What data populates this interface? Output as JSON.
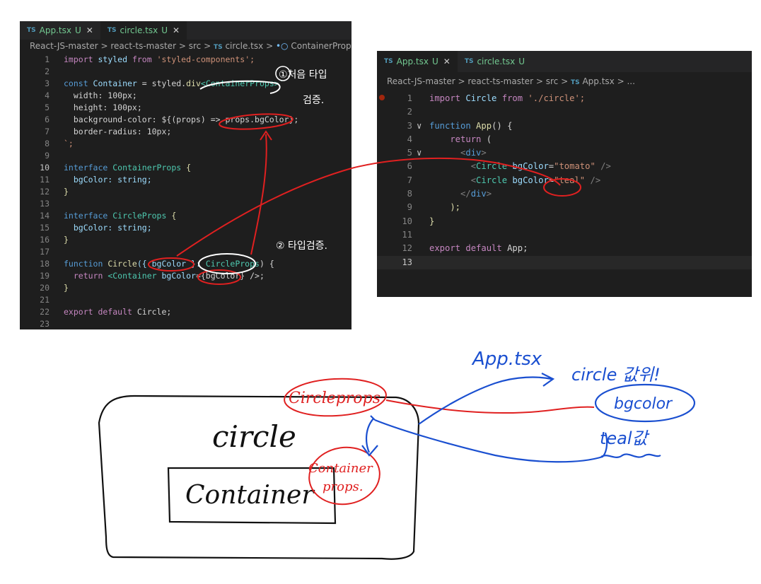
{
  "left_editor": {
    "tabs": [
      {
        "lang": "TS",
        "name": "App.tsx",
        "status": "U",
        "close": "✕",
        "active": false
      },
      {
        "lang": "TS",
        "name": "circle.tsx",
        "status": "U",
        "close": "✕",
        "active": true
      }
    ],
    "breadcrumb": {
      "p1": "React-JS-master",
      "p2": "react-ts-master",
      "p3": "src",
      "lang": "TS",
      "p4": "circle.tsx",
      "p5": "ContainerProps",
      "sep": ">",
      "sym": "•○"
    },
    "lines": [
      {
        "n": "1",
        "a": "import",
        "b": " styled ",
        "c": "from",
        "d": " 'styled-components';"
      },
      {
        "n": "2"
      },
      {
        "n": "3",
        "a": "const",
        "b": " Container",
        "c": " = styled.",
        "d": "div",
        "e": "<ContainerProps>`"
      },
      {
        "n": "4",
        "a": "  width: 100px;"
      },
      {
        "n": "5",
        "a": "  height: 100px;"
      },
      {
        "n": "6",
        "a": "  background-color: ${(props) => props.bgColor};"
      },
      {
        "n": "7",
        "a": "  border-radius: 10px;"
      },
      {
        "n": "8",
        "a": "`;"
      },
      {
        "n": "9"
      },
      {
        "n": "10",
        "a": "interface",
        "b": " ContainerProps",
        "c": " {"
      },
      {
        "n": "11",
        "a": "  bgColor: string;"
      },
      {
        "n": "12",
        "a": "}"
      },
      {
        "n": "13"
      },
      {
        "n": "14",
        "a": "interface",
        "b": " CircleProps",
        "c": " {"
      },
      {
        "n": "15",
        "a": "  bgColor: string;"
      },
      {
        "n": "16",
        "a": "}"
      },
      {
        "n": "17"
      },
      {
        "n": "18",
        "a": "function",
        "b": " Circle",
        "c": "({ bgColor }: ",
        "d": "CircleProps",
        "e": ") {"
      },
      {
        "n": "19",
        "a": "  return",
        "b": " <Container ",
        "c": "bgColor",
        "d": "={bgColor} />;"
      },
      {
        "n": "20",
        "a": "}"
      },
      {
        "n": "21"
      },
      {
        "n": "22",
        "a": "export default",
        "b": " Circle;"
      },
      {
        "n": "23"
      }
    ]
  },
  "right_editor": {
    "tabs": [
      {
        "lang": "TS",
        "name": "App.tsx",
        "status": "U",
        "close": "✕",
        "active": true
      },
      {
        "lang": "TS",
        "name": "circle.tsx",
        "status": "U",
        "active": false
      }
    ],
    "breadcrumb": {
      "p1": "React-JS-master",
      "p2": "react-ts-master",
      "p3": "src",
      "lang": "TS",
      "p4": "App.tsx",
      "p5": "...",
      "sep": ">"
    },
    "lines": [
      {
        "n": "1",
        "a": "import",
        "b": " Circle ",
        "c": "from",
        "d": " './circle';"
      },
      {
        "n": "2"
      },
      {
        "n": "3",
        "fold": "∨",
        "a": "function",
        "b": " App",
        "c": "() {"
      },
      {
        "n": "4",
        "a": "    return",
        "b": " ("
      },
      {
        "n": "5",
        "fold": "∨",
        "a": "      <",
        "b": "div",
        "c": ">"
      },
      {
        "n": "6",
        "a": "        <",
        "b": "Circle",
        "c": " bgColor",
        "d": "=",
        "e": "\"tomato\"",
        "f": " />"
      },
      {
        "n": "7",
        "a": "        <",
        "b": "Circle",
        "c": " bgColor",
        "d": "=",
        "e": "\"teal\"",
        "f": " />"
      },
      {
        "n": "8",
        "a": "      </",
        "b": "div",
        "c": ">"
      },
      {
        "n": "9",
        "a": "    );"
      },
      {
        "n": "10",
        "a": "}"
      },
      {
        "n": "11"
      },
      {
        "n": "12",
        "a": "export default",
        "b": " App;"
      },
      {
        "n": "13"
      }
    ]
  },
  "annotations": {
    "note1": "①처음 타입",
    "note1b": "검증.",
    "note2": "② 타입검증.",
    "diagram_circle": "circle",
    "diagram_container": "Container",
    "circleprops": "Circleprops",
    "containerprops1": "Container",
    "containerprops2": "props.",
    "app_tsx": "App.tsx",
    "circle_value": "circle 값위!",
    "bgcolor": "bgcolor",
    "teal": "teal값"
  }
}
